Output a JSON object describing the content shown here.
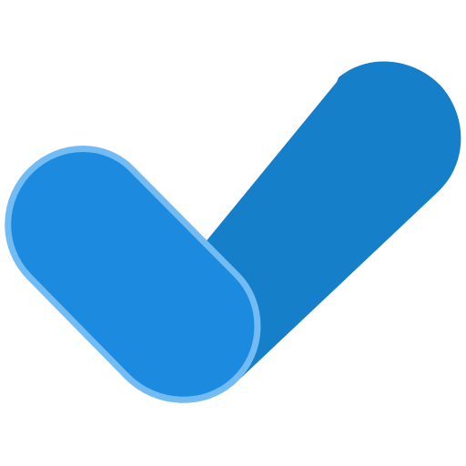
{
  "icon": {
    "name": "checkmark-icon",
    "colors": {
      "long_stroke": "#157FCA",
      "short_stroke_fill": "#1C8BDF",
      "short_stroke_outline": "#73BBF3",
      "background": "#FFFFFF"
    }
  }
}
